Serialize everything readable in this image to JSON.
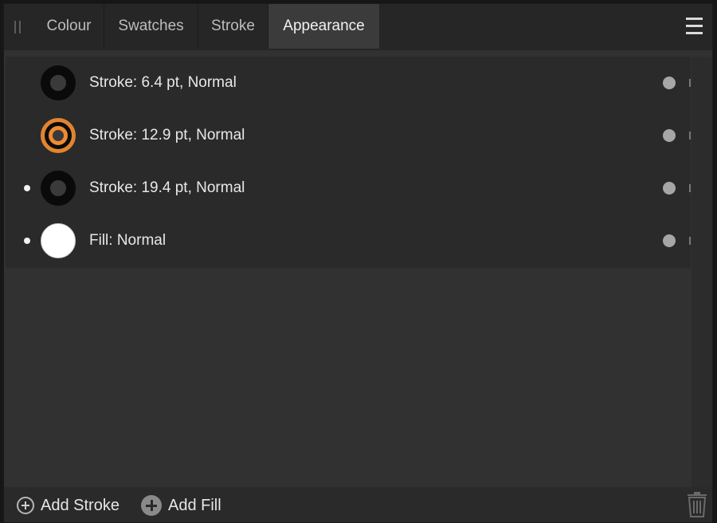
{
  "tabs": [
    {
      "label": "Colour",
      "active": false
    },
    {
      "label": "Swatches",
      "active": false
    },
    {
      "label": "Stroke",
      "active": false
    },
    {
      "label": "Appearance",
      "active": true
    }
  ],
  "icons": {
    "grip": "grip-icon",
    "menu": "hamburger-menu-icon",
    "add_stroke": "plus-circle-outline-icon",
    "add_fill": "plus-circle-filled-icon",
    "delete": "trash-icon"
  },
  "colors": {
    "panel_bg": "#313131",
    "list_bg": "#2a2a2a",
    "accent_orange": "#f08a30"
  },
  "layers": [
    {
      "label": "Stroke: 6.4 pt, Normal",
      "type": "stroke",
      "swatch_color": "#0a0a0a",
      "visible_dot": false
    },
    {
      "label": "Stroke: 12.9 pt, Normal",
      "type": "stroke",
      "swatch_color": "#f08a30",
      "visible_dot": false
    },
    {
      "label": "Stroke: 19.4 pt, Normal",
      "type": "stroke",
      "swatch_color": "#0a0a0a",
      "visible_dot": true
    },
    {
      "label": "Fill: Normal",
      "type": "fill",
      "swatch_color": "#ffffff",
      "visible_dot": true
    }
  ],
  "footer": {
    "add_stroke_label": "Add Stroke",
    "add_fill_label": "Add Fill"
  }
}
